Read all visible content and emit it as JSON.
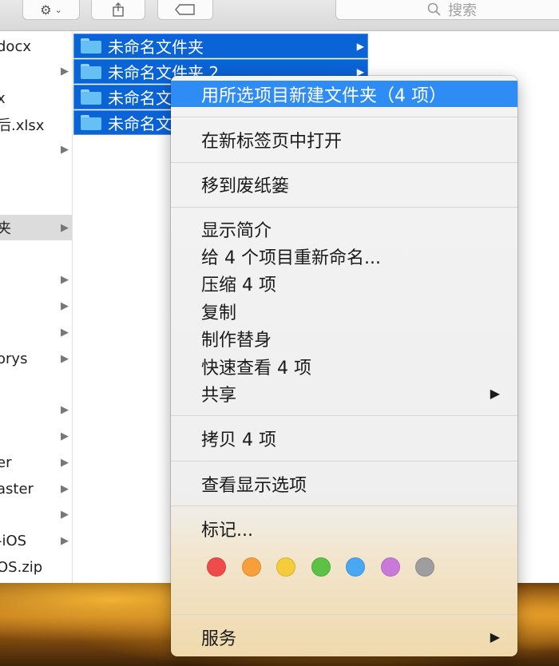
{
  "search": {
    "placeholder": "搜索"
  },
  "left_column": {
    "items": [
      {
        "label": "docx",
        "arrow": ""
      },
      {
        "label": "",
        "arrow": "▶"
      },
      {
        "label": "x",
        "arrow": ""
      },
      {
        "label": "后.xlsx",
        "arrow": ""
      },
      {
        "label": "",
        "arrow": "▶"
      },
      {
        "label": "夹",
        "arrow": "▶"
      },
      {
        "label": "",
        "arrow": "▶"
      },
      {
        "label": "",
        "arrow": "▶"
      },
      {
        "label": "",
        "arrow": "▶"
      },
      {
        "label": "orys",
        "arrow": "▶"
      },
      {
        "label": "",
        "arrow": "▶"
      },
      {
        "label": "",
        "arrow": "▶"
      },
      {
        "label": "er",
        "arrow": "▶"
      },
      {
        "label": "aster",
        "arrow": "▶"
      },
      {
        "label": "",
        "arrow": "▶"
      },
      {
        "label": "-iOS",
        "arrow": "▶"
      },
      {
        "label": "OS.zip",
        "arrow": ""
      }
    ]
  },
  "selected_folders": [
    {
      "name": "未命名文件夹"
    },
    {
      "name": "未命名文件夹 2"
    },
    {
      "name": "未命名文"
    },
    {
      "name": "未命名文"
    }
  ],
  "context_menu": {
    "new_folder_with_selection": "用所选项目新建文件夹（4 项）",
    "open_in_new_tab": "在新标签页中打开",
    "move_to_trash": "移到废纸篓",
    "get_info": "显示简介",
    "rename_items": "给 4 个项目重新命名...",
    "compress": "压缩 4 项",
    "duplicate": "复制",
    "make_alias": "制作替身",
    "quick_look": "快速查看 4 项",
    "share": "共享",
    "copy": "拷贝 4 项",
    "show_view_options": "查看显示选项",
    "tags": "标记...",
    "services": "服务",
    "submenu_arrow": "▶",
    "tag_colors": [
      "#f04b4b",
      "#f7a03b",
      "#f5cc3a",
      "#5cc144",
      "#4aa7f2",
      "#c97ad9",
      "#9e9e9e"
    ]
  }
}
